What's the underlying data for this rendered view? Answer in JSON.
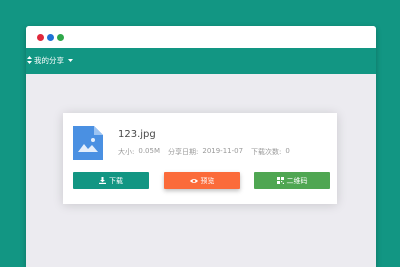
{
  "colors": {
    "brand_teal": "#129683",
    "preview_orange": "#fb6b3a",
    "qrcode_green": "#4fa652",
    "window_bg": "#ecebf0",
    "dot_red": "#e0283c",
    "dot_blue": "#1f72d6",
    "dot_green": "#2fa84a",
    "file_icon_blue": "#4a90e2"
  },
  "navbar": {
    "menu_label": "我的分享",
    "menu_icon": "sort-icon",
    "caret_icon": "caret-down-icon"
  },
  "file": {
    "name": "123.jpg",
    "icon": "image-file-icon",
    "size_label": "大小:",
    "size_value": "0.05M",
    "share_date_label": "分享日期:",
    "share_date_value": "2019-11-07",
    "download_count_label": "下载次数:",
    "download_count_value": "0"
  },
  "actions": {
    "download_label": "下载",
    "download_icon": "download-icon",
    "preview_label": "预览",
    "preview_icon": "eye-icon",
    "qrcode_label": "二维码",
    "qrcode_icon": "qrcode-icon"
  }
}
